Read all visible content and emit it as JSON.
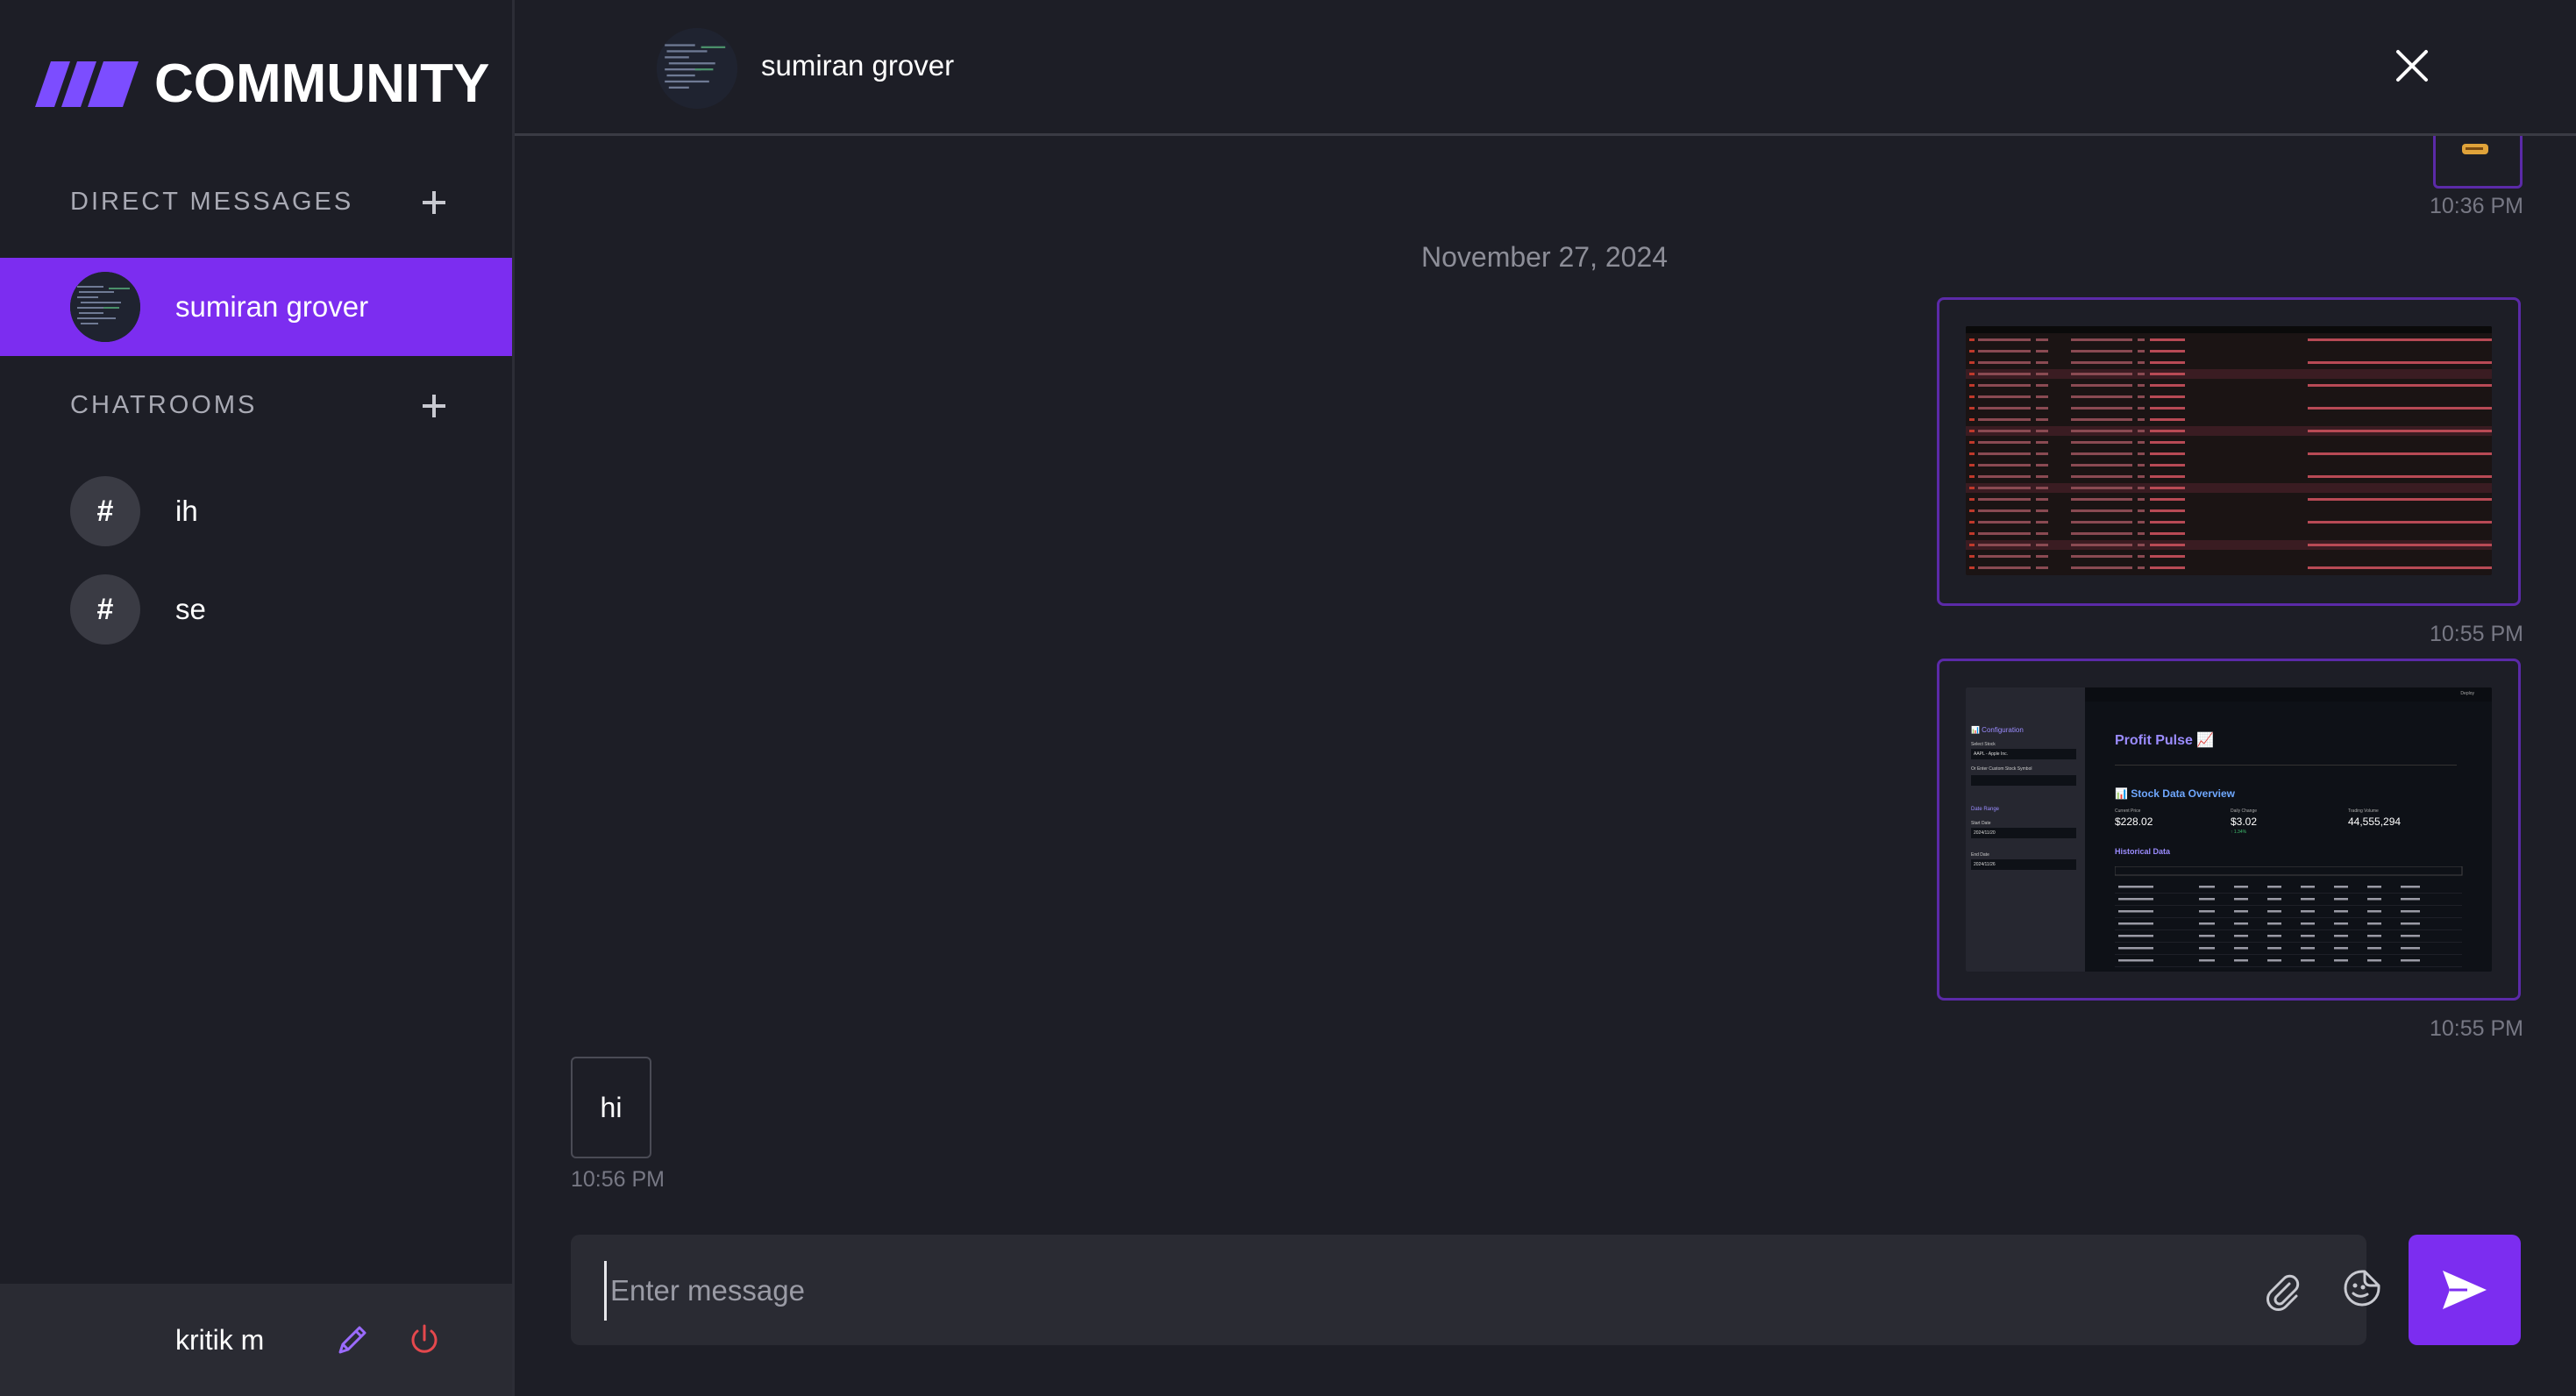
{
  "app": {
    "title": "COMMUNITY",
    "brand_color": "#7c2df0"
  },
  "sidebar": {
    "direct_messages_label": "DIRECT MESSAGES",
    "direct_messages": [
      {
        "name": "sumiran grover",
        "active": true
      }
    ],
    "chatrooms_label": "CHATROOMS",
    "chatrooms": [
      {
        "symbol": "#",
        "name": "ih"
      },
      {
        "symbol": "#",
        "name": "se"
      }
    ],
    "icons": {
      "add": "plus-icon"
    }
  },
  "footer": {
    "username": "kritik m",
    "edit_icon": "pencil-icon",
    "logout_icon": "power-icon"
  },
  "chat": {
    "header": {
      "name": "sumiran grover",
      "close_icon": "close-icon"
    },
    "messages": [
      {
        "type": "image",
        "time": "10:36 PM",
        "from": "me",
        "partial": true
      },
      {
        "type": "date",
        "text": "November 27, 2024"
      },
      {
        "type": "image",
        "time": "10:55 PM",
        "from": "me",
        "content": "error log screenshot"
      },
      {
        "type": "image",
        "time": "10:55 PM",
        "from": "me",
        "content": {
          "app_title": "Profit Pulse 📈",
          "side_title": "📊 Configuration",
          "side_select_label": "Select Stock",
          "side_select_value": "AAPL - Apple Inc.",
          "side_custom": "Or Enter Custom Stock Symbol",
          "date_range": "Date Range",
          "start_date_label": "Start Date",
          "start_date": "2024/11/20",
          "end_date_label": "End Date",
          "end_date": "2024/11/26",
          "deploy": "Deploy",
          "overview_title": "📊 Stock Data Overview",
          "current_price_label": "Current Price",
          "current_price": "$228.02",
          "daily_change_label": "Daily Change",
          "daily_change": "$3.02",
          "daily_change_pct": "↑ 1.34%",
          "volume_label": "Trading Volume",
          "volume": "44,555,294",
          "historical_title": "Historical Data"
        }
      },
      {
        "type": "text",
        "text": "hi",
        "time": "10:56 PM",
        "from": "them"
      }
    ]
  },
  "composer": {
    "placeholder": "Enter message",
    "value": "",
    "attach_icon": "paperclip-icon",
    "sticker_icon": "sticker-icon",
    "send_icon": "send-icon"
  }
}
